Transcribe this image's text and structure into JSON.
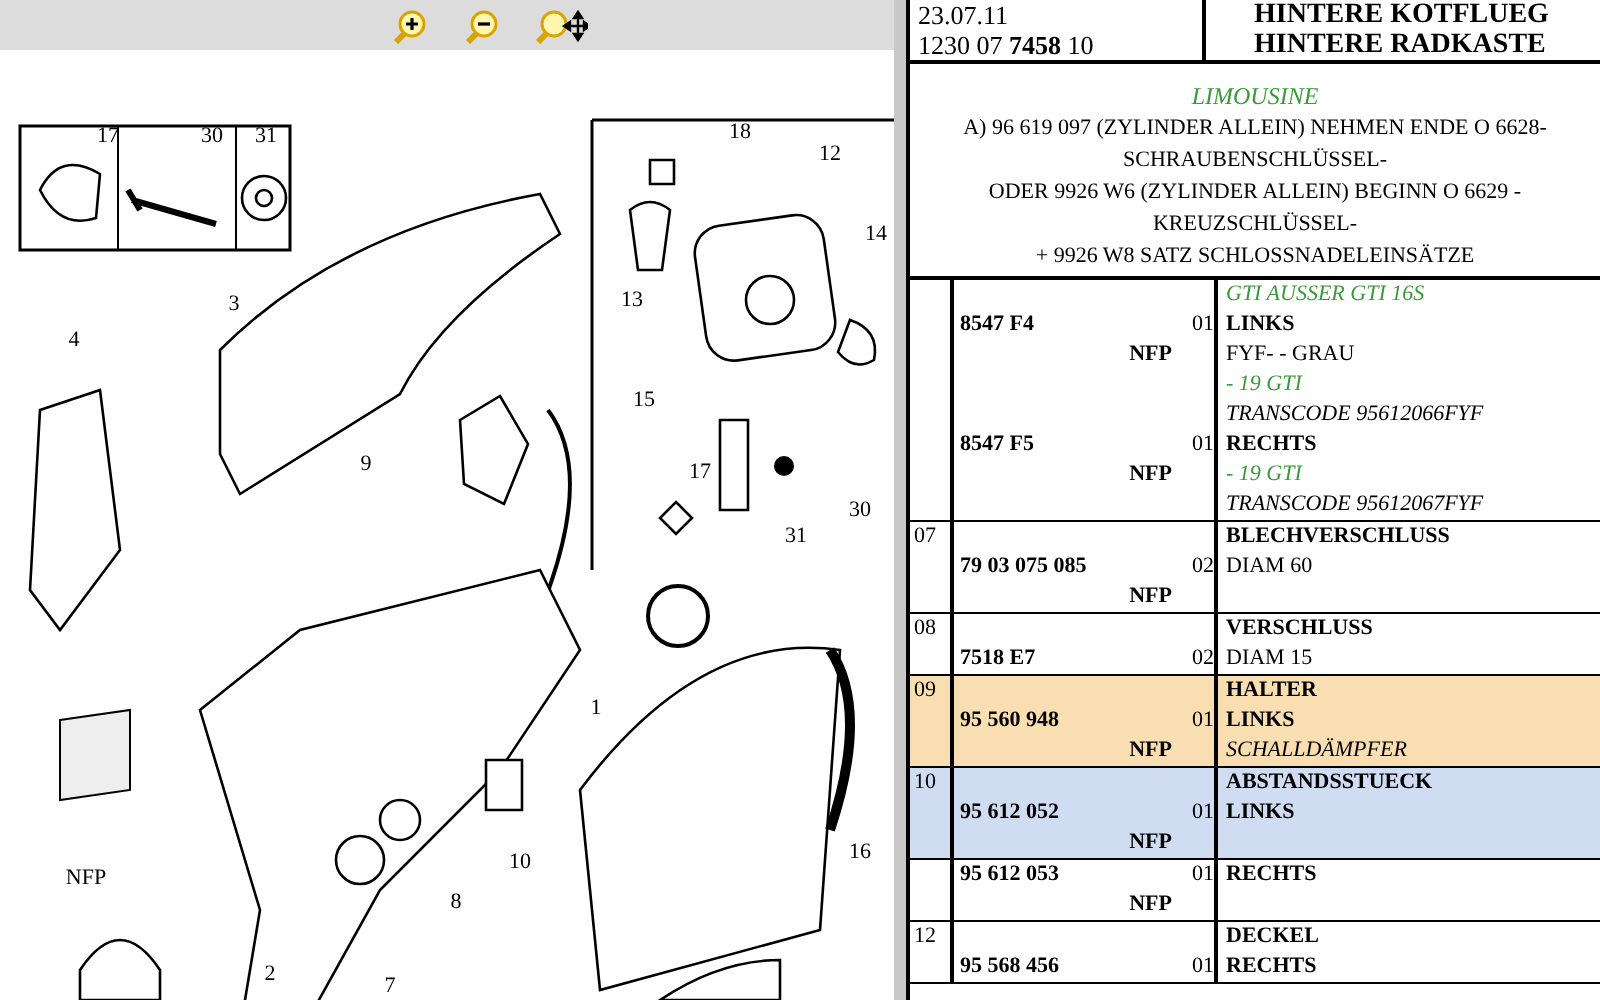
{
  "toolbar": {
    "buttons": [
      {
        "kind": "zoom-in"
      },
      {
        "kind": "zoom-out"
      },
      {
        "kind": "pan"
      }
    ]
  },
  "diagram": {
    "callouts": [
      "17",
      "30",
      "31",
      "18",
      "12",
      "3",
      "4",
      "13",
      "14",
      "15",
      "9",
      "17",
      "31",
      "30",
      "NFP",
      "1",
      "10",
      "8",
      "16",
      "7",
      "2"
    ]
  },
  "header": {
    "date": "23.07.11",
    "code": "1230 07 **7458** 10",
    "title_lines": [
      "HINTERE KOTFLUEG",
      "HINTERE RADKASTE"
    ]
  },
  "notes": {
    "model": "LIMOUSINE",
    "lines": [
      "A) 96 619 097 (ZYLINDER ALLEIN) NEHMEN ENDE O 6628-",
      "SCHRAUBENSCHLÜSSEL-",
      "ODER 9926 W6 (ZYLINDER ALLEIN) BEGINN O 6629 -",
      "KREUZSCHLÜSSEL-",
      "+ 9926 W8 SATZ SCHLOSSNADELEINSÄTZE"
    ]
  },
  "parts": [
    {
      "lines": [
        {
          "kind": "green",
          "text": "GTI AUSSER GTI 16S"
        },
        {
          "part": "8547 F4",
          "qty": "01",
          "kind": "bold",
          "text": "LINKS"
        },
        {
          "nfp": "NFP",
          "kind": "plain",
          "text": "FYF- - GRAU"
        },
        {
          "kind": "green",
          "text": "- 19 GTI"
        },
        {
          "kind": "italic",
          "text": "TRANSCODE 95612066FYF"
        },
        {
          "part": "8547 F5",
          "qty": "01",
          "kind": "bold",
          "text": "RECHTS"
        },
        {
          "nfp": "NFP",
          "kind": "green",
          "text": "- 19 GTI"
        },
        {
          "kind": "italic",
          "text": "TRANSCODE 95612067FYF"
        }
      ]
    },
    {
      "no": "07",
      "lines": [
        {
          "kind": "bold",
          "text": "BLECHVERSCHLUSS"
        },
        {
          "part": "79 03 075 085",
          "qty": "02",
          "kind": "plain",
          "text": "DIAM 60"
        },
        {
          "nfp": "NFP"
        }
      ]
    },
    {
      "no": "08",
      "lines": [
        {
          "kind": "bold",
          "text": "VERSCHLUSS"
        },
        {
          "part": "7518 E7",
          "qty": "02",
          "kind": "plain",
          "text": "DIAM 15"
        }
      ]
    },
    {
      "no": "09",
      "color": "#f8deb0",
      "lines": [
        {
          "kind": "bold",
          "text": "HALTER"
        },
        {
          "part": "95 560 948",
          "qty": "01",
          "kind": "bold",
          "text": "LINKS"
        },
        {
          "nfp": "NFP",
          "kind": "italic",
          "text": "SCHALLDÄMPFER"
        }
      ]
    },
    {
      "no": "10",
      "color": "#cfdcf2",
      "lines": [
        {
          "kind": "bold",
          "text": "ABSTANDSSTUECK"
        },
        {
          "part": "95 612 052",
          "qty": "01",
          "kind": "bold",
          "text": "LINKS"
        },
        {
          "nfp": "NFP"
        }
      ]
    },
    {
      "lines": [
        {
          "part": "95 612 053",
          "qty": "01",
          "kind": "bold",
          "text": "RECHTS"
        },
        {
          "nfp": "NFP"
        }
      ]
    },
    {
      "no": "12",
      "lines": [
        {
          "kind": "bold",
          "text": "DECKEL"
        },
        {
          "part": "95 568 456",
          "qty": "01",
          "kind": "bold",
          "text": "RECHTS"
        }
      ]
    }
  ]
}
